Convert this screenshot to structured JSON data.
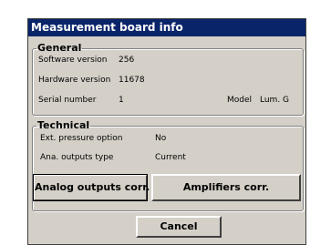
{
  "dialog": {
    "title": "Measurement board info"
  },
  "general": {
    "legend": "General",
    "software_version_label": "Software version",
    "software_version_value": "256",
    "hardware_version_label": "Hardware version",
    "hardware_version_value": "11678",
    "serial_number_label": "Serial number",
    "serial_number_value": "1",
    "model_label": "Model",
    "model_value": "Lum. G"
  },
  "technical": {
    "legend": "Technical",
    "ext_pressure_label": "Ext. pressure option",
    "ext_pressure_value": "No",
    "ana_outputs_label": "Ana. outputs type",
    "ana_outputs_value": "Current"
  },
  "buttons": {
    "analog_outputs": "Analog outputs corr.",
    "amplifiers": "Amplifiers corr.",
    "cancel": "Cancel"
  },
  "colors": {
    "titlebar": "#0a246a",
    "dialog_bg": "#d4d0c8"
  }
}
